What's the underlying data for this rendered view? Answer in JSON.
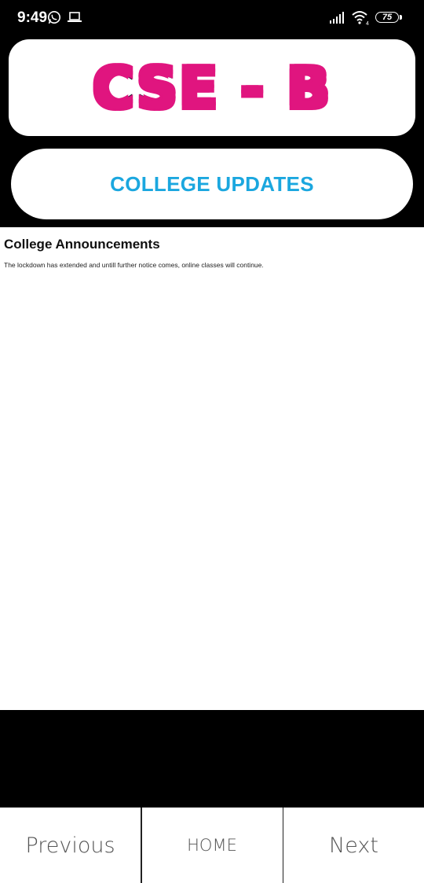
{
  "status_bar": {
    "time": "9:49",
    "battery": "75",
    "icons": [
      "whatsapp-icon",
      "laptop-icon",
      "signal-icon",
      "wifi-icon",
      "battery-icon"
    ]
  },
  "header": {
    "logo_text": "CSE - B",
    "updates_button_label": "COLLEGE UPDATES"
  },
  "content": {
    "title": "College Announcements",
    "body": "The lockdown has extended and untill further notice comes, online classes will continue."
  },
  "bottom_nav": {
    "previous": "Previous",
    "home": "HOME",
    "next": "Next"
  },
  "colors": {
    "accent": "#1ba7df",
    "logo_outline": "#e0157f",
    "background": "#000000"
  }
}
